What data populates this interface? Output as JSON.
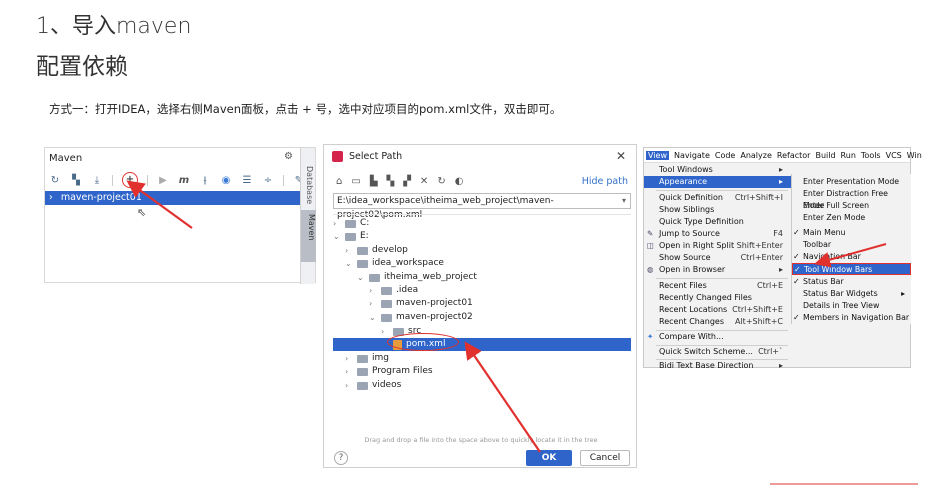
{
  "heading": "1、导入maven",
  "subheading": "配置依赖",
  "instruction": "方式一：打开IDEA，选择右侧Maven面板，点击 + 号，选中对应项目的pom.xml文件，双击即可。",
  "maven_panel": {
    "title": "Maven",
    "project_row": "maven-project01",
    "side_tabs": [
      "Database",
      "Maven"
    ],
    "toolbar_icons": [
      "refresh-icon",
      "reimport-icon",
      "download-icon",
      "add-icon",
      "run-icon",
      "m-icon",
      "toggle-offline-icon",
      "lifecycle-icon",
      "collapse-icon",
      "expand-icon",
      "settings-icon"
    ]
  },
  "select_path": {
    "title": "Select Path",
    "hide_path": "Hide path",
    "path": "E:\\idea_workspace\\itheima_web_project\\maven-project02\\pom.xml",
    "tree": [
      {
        "label": "C:",
        "level": 0,
        "expanded": false
      },
      {
        "label": "E:",
        "level": 0,
        "expanded": true
      },
      {
        "label": "develop",
        "level": 1,
        "expanded": false
      },
      {
        "label": "idea_workspace",
        "level": 1,
        "expanded": true
      },
      {
        "label": "itheima_web_project",
        "level": 2,
        "expanded": true
      },
      {
        "label": ".idea",
        "level": 3,
        "expanded": false
      },
      {
        "label": "maven-project01",
        "level": 3,
        "expanded": false
      },
      {
        "label": "maven-project02",
        "level": 3,
        "expanded": true
      },
      {
        "label": "src",
        "level": 4,
        "expanded": false
      },
      {
        "label": "pom.xml",
        "level": 4,
        "selected": true
      },
      {
        "label": "img",
        "level": 1,
        "expanded": false
      },
      {
        "label": "Program Files",
        "level": 1,
        "expanded": false
      },
      {
        "label": "videos",
        "level": 1,
        "expanded": false
      }
    ],
    "drop_hint": "Drag and drop a file into the space above to quickly locate it in the tree",
    "help": "?",
    "ok": "OK",
    "cancel": "Cancel"
  },
  "view_menu": {
    "menubar": [
      "View",
      "Navigate",
      "Code",
      "Analyze",
      "Refactor",
      "Build",
      "Run",
      "Tools",
      "VCS",
      "Win"
    ],
    "items": [
      {
        "label": "Tool Windows",
        "shortcut": "▸"
      },
      {
        "label": "Appearance",
        "shortcut": "▸",
        "highlighted": true
      },
      {
        "label": "Quick Definition",
        "shortcut": "Ctrl+Shift+I"
      },
      {
        "label": "Show Siblings",
        "shortcut": ""
      },
      {
        "label": "Quick Type Definition",
        "shortcut": ""
      },
      {
        "label": "Jump to Source",
        "shortcut": "F4"
      },
      {
        "label": "Open in Right Split",
        "shortcut": "Shift+Enter"
      },
      {
        "label": "Show Source",
        "shortcut": "Ctrl+Enter"
      },
      {
        "label": "Open in Browser",
        "shortcut": "▸"
      },
      {
        "label": "Recent Files",
        "shortcut": "Ctrl+E"
      },
      {
        "label": "Recently Changed Files",
        "shortcut": ""
      },
      {
        "label": "Recent Locations",
        "shortcut": "Ctrl+Shift+E"
      },
      {
        "label": "Recent Changes",
        "shortcut": "Alt+Shift+C"
      },
      {
        "label": "Compare With...",
        "shortcut": ""
      },
      {
        "label": "Quick Switch Scheme...",
        "shortcut": "Ctrl+`"
      },
      {
        "label": "Bidi Text Base Direction",
        "shortcut": "▸"
      }
    ],
    "submenu": [
      {
        "label": "Enter Presentation Mode",
        "check": false
      },
      {
        "label": "Enter Distraction Free Mode",
        "check": false
      },
      {
        "label": "Enter Full Screen",
        "check": false
      },
      {
        "label": "Enter Zen Mode",
        "check": false
      },
      {
        "label": "Main Menu",
        "check": true
      },
      {
        "label": "Toolbar",
        "check": false
      },
      {
        "label": "Navigation Bar",
        "check": true
      },
      {
        "label": "Tool Window Bars",
        "check": true,
        "highlighted": true
      },
      {
        "label": "Status Bar",
        "check": true
      },
      {
        "label": "Status Bar Widgets",
        "check": false,
        "arrow": "▸"
      },
      {
        "label": "Details in Tree View",
        "check": false
      },
      {
        "label": "Members in Navigation Bar",
        "check": true
      }
    ]
  },
  "colors": {
    "selection_blue": "#2f65ca",
    "annotation_red": "#e0312f"
  }
}
